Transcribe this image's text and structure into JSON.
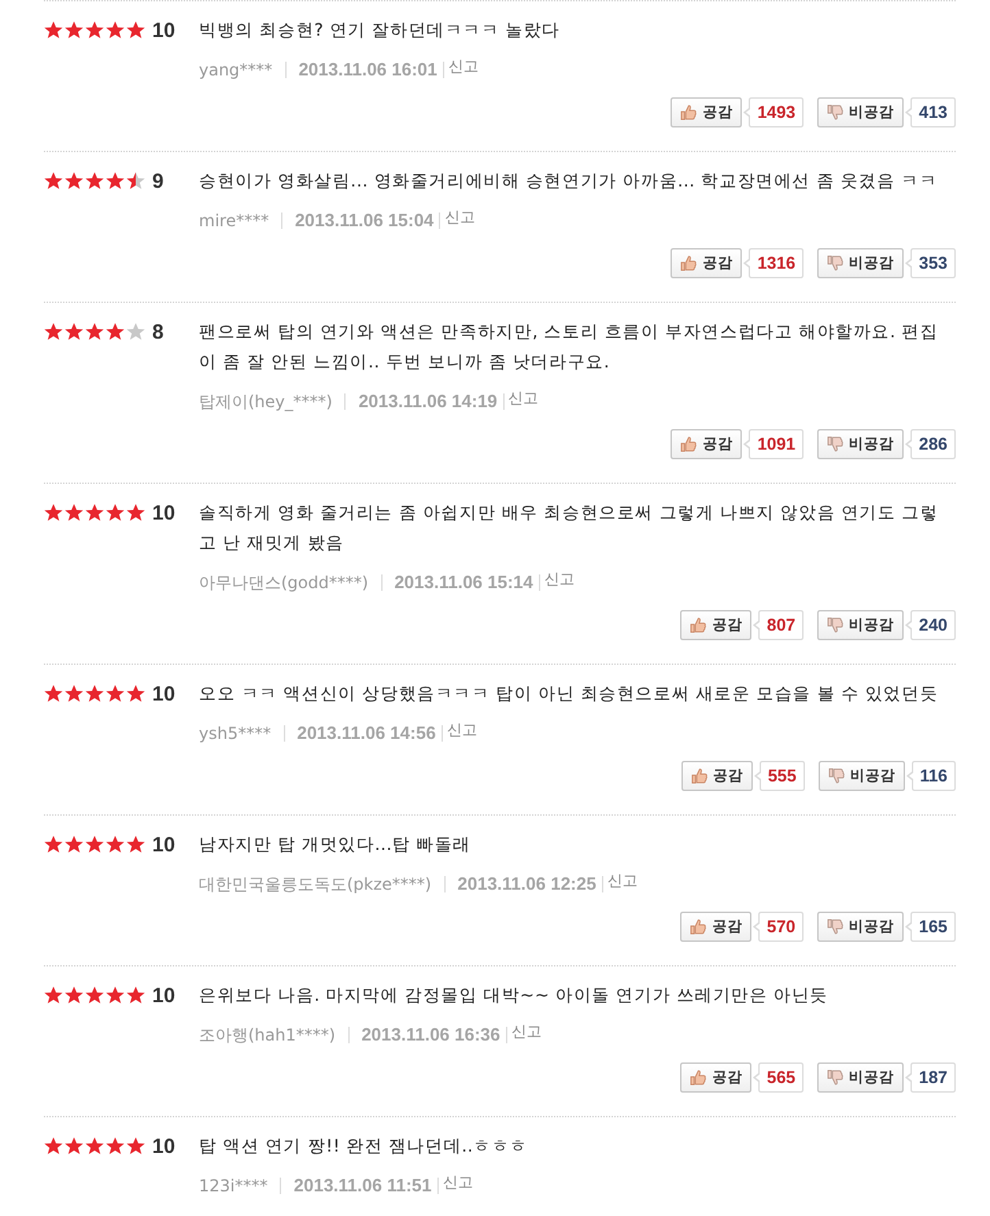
{
  "comments": [
    {
      "stars": 5,
      "score": "10",
      "text": "빅뱅의 최승현? 연기 잘하던데ㅋㅋㅋ 놀랐다",
      "user": "yang****",
      "date": "2013.11.06 16:01",
      "report": "신고",
      "like": {
        "label": "공감",
        "count": "1493"
      },
      "dislike": {
        "label": "비공감",
        "count": "413"
      }
    },
    {
      "stars": 4.5,
      "score": "9",
      "text": "승현이가 영화살림... 영화줄거리에비해 승현연기가 아까움... 학교장면에선 좀 웃겼음 ㅋㅋ",
      "user": "mire****",
      "date": "2013.11.06 15:04",
      "report": "신고",
      "like": {
        "label": "공감",
        "count": "1316"
      },
      "dislike": {
        "label": "비공감",
        "count": "353"
      }
    },
    {
      "stars": 4,
      "score": "8",
      "text": "팬으로써 탑의 연기와 액션은 만족하지만, 스토리 흐름이 부자연스럽다고 해야할까요. 편집이 좀 잘 안된 느낌이.. 두번 보니까 좀 낫더라구요.",
      "user": "탑제이(hey_****)",
      "date": "2013.11.06 14:19",
      "report": "신고",
      "like": {
        "label": "공감",
        "count": "1091"
      },
      "dislike": {
        "label": "비공감",
        "count": "286"
      }
    },
    {
      "stars": 5,
      "score": "10",
      "text": "솔직하게 영화 줄거리는 좀 아쉽지만 배우 최승현으로써 그렇게 나쁘지 않았음 연기도 그렇고 난 재밋게 봤음",
      "user": "아무나댄스(godd****)",
      "date": "2013.11.06 15:14",
      "report": "신고",
      "like": {
        "label": "공감",
        "count": "807"
      },
      "dislike": {
        "label": "비공감",
        "count": "240"
      }
    },
    {
      "stars": 5,
      "score": "10",
      "text": "오오 ㅋㅋ 액션신이 상당했음ㅋㅋㅋ 탑이 아닌 최승현으로써 새로운 모습을 볼 수 있었던듯",
      "user": "ysh5****",
      "date": "2013.11.06 14:56",
      "report": "신고",
      "like": {
        "label": "공감",
        "count": "555"
      },
      "dislike": {
        "label": "비공감",
        "count": "116"
      }
    },
    {
      "stars": 5,
      "score": "10",
      "text": "남자지만 탑 개멋있다...탑 빠돌래",
      "user": "대한민국울릉도독도(pkze****)",
      "date": "2013.11.06 12:25",
      "report": "신고",
      "like": {
        "label": "공감",
        "count": "570"
      },
      "dislike": {
        "label": "비공감",
        "count": "165"
      }
    },
    {
      "stars": 5,
      "score": "10",
      "text": "은위보다 나음. 마지막에 감정몰입 대박~~ 아이돌 연기가 쓰레기만은 아닌듯",
      "user": "조아행(hah1****)",
      "date": "2013.11.06 16:36",
      "report": "신고",
      "like": {
        "label": "공감",
        "count": "565"
      },
      "dislike": {
        "label": "비공감",
        "count": "187"
      }
    },
    {
      "stars": 5,
      "score": "10",
      "text": "탑 액션 연기 짱!! 완전 잼나던데..ㅎㅎㅎ",
      "user": "123i****",
      "date": "2013.11.06 11:51",
      "report": "신고"
    }
  ]
}
